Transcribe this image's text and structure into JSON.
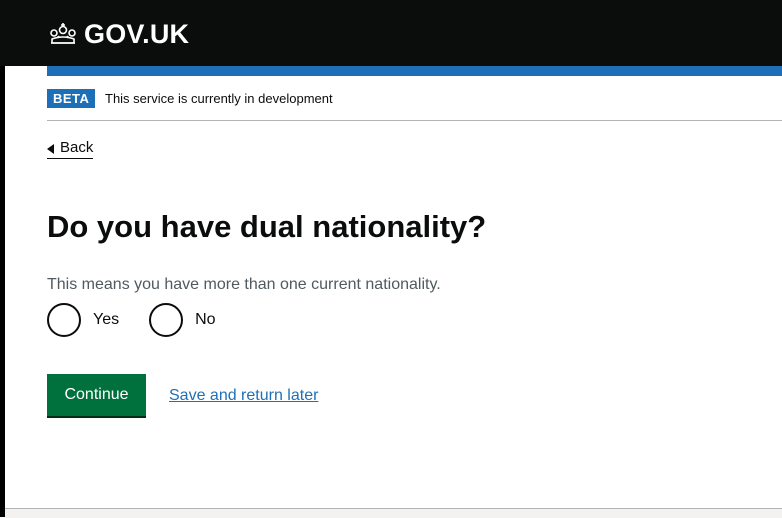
{
  "header": {
    "logo_text": "GOV.UK",
    "logo_icon": "crown-icon"
  },
  "phase_banner": {
    "tag": "BETA",
    "text": "This service is currently in development"
  },
  "back_link": {
    "label": "Back"
  },
  "question": {
    "heading": "Do you have dual nationality?",
    "hint": "This means you have more than one current nationality.",
    "options": [
      {
        "label": "Yes",
        "selected": false
      },
      {
        "label": "No",
        "selected": false
      }
    ]
  },
  "actions": {
    "continue_label": "Continue",
    "save_label": "Save and return later"
  },
  "colors": {
    "header_bg": "#0b0c0c",
    "brand_blue": "#1d70b8",
    "button_green": "#00703c",
    "link_blue": "#1d70b8",
    "hint_grey": "#505a5f"
  }
}
